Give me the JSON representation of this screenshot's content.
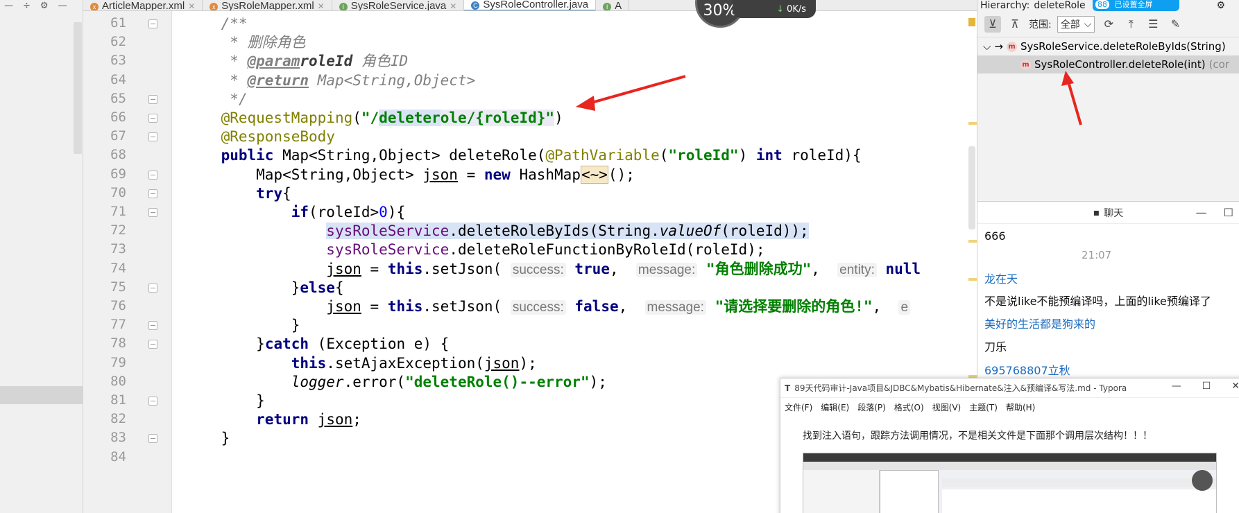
{
  "left_tools": [
    "—",
    "÷",
    "⚙",
    "—"
  ],
  "tabs": [
    {
      "label": "ArticleMapper.xml",
      "kind": "xml",
      "active": false
    },
    {
      "label": "SysRoleMapper.xml",
      "kind": "xml",
      "active": false
    },
    {
      "label": "SysRoleService.java",
      "kind": "interface",
      "active": false
    },
    {
      "label": "SysRoleController.java",
      "kind": "class",
      "active": true
    },
    {
      "label": "A",
      "kind": "interface",
      "active": false
    }
  ],
  "speed_widget": {
    "percent": "30%",
    "down_arrow": "↓",
    "rate": "0K/s"
  },
  "qq_float": {
    "badge": "88",
    "text": "已设置全屏"
  },
  "editor": {
    "line_numbers": [
      "61",
      "62",
      "63",
      "64",
      "65",
      "66",
      "67",
      "68",
      "69",
      "70",
      "71",
      "72",
      "73",
      "74",
      "75",
      "76",
      "77",
      "78",
      "79",
      "80",
      "81",
      "82",
      "83",
      "84"
    ],
    "l61": {
      "text": "    /**"
    },
    "l62": {
      "text": "     * 删除角色"
    },
    "l63": {
      "star": "     * ",
      "tag": "@param",
      "name": "roleId",
      "desc": " 角色ID"
    },
    "l64": {
      "star": "     * ",
      "tag": "@return",
      "desc": " Map<String,Object>"
    },
    "l65": {
      "text": "     */"
    },
    "l66": {
      "indent": "    ",
      "ann": "@RequestMapping",
      "p1": "(",
      "q": "\"/",
      "sel": "deleter",
      "rest": "ole/{roleId}\"",
      "p2": ")"
    },
    "l67": {
      "indent": "    ",
      "ann": "@ResponseBody"
    },
    "l68": {
      "indent": "    ",
      "kw": "public",
      "t1": " Map<String,Object> deleteRole(",
      "ann": "@PathVariable",
      "t2": "(",
      "str": "\"roleId\"",
      "t3": ") ",
      "kw2": "int",
      "t4": " roleId){"
    },
    "l69": {
      "indent": "        ",
      "t1": "Map<String,Object> ",
      "var": "json",
      "t2": " = ",
      "kw": "new",
      "t3": " HashMap",
      "dia": "<~>",
      "t4": "();"
    },
    "l70": {
      "indent": "        ",
      "kw": "try",
      "t1": "{"
    },
    "l71": {
      "indent": "            ",
      "kw": "if",
      "t1": "(roleId>",
      "num": "0",
      "t2": "){"
    },
    "l72": {
      "indent": "                ",
      "fld": "sysRoleService",
      "t1": ".deleteRoleByIds(String.",
      "ital": "valueOf",
      "t2": "(roleId));"
    },
    "l73": {
      "indent": "                ",
      "fld": "sysRoleService",
      "t1": ".deleteRoleFunctionByRoleId(roleId);"
    },
    "l74": {
      "indent": "                ",
      "var": "json",
      "t1": " = ",
      "kw": "this",
      "t2": ".setJson( ",
      "h1": "success:",
      "kw2": " true",
      "t3": ",  ",
      "h2": "message:",
      "str": " \"角色删除成功\"",
      "t4": ",  ",
      "h3": "entity:",
      "kw3": " null"
    },
    "l75": {
      "indent": "            ",
      "t1": "}",
      "kw": "else",
      "t2": "{"
    },
    "l76": {
      "indent": "                ",
      "var": "json",
      "t1": " = ",
      "kw": "this",
      "t2": ".setJson( ",
      "h1": "success:",
      "kw2": " false",
      "t3": ",  ",
      "h2": "message:",
      "str": " \"请选择要删除的角色!\"",
      "t4": ",  ",
      "h3": "e"
    },
    "l77": {
      "indent": "            ",
      "t1": "}"
    },
    "l78": {
      "indent": "        ",
      "t1": "}",
      "kw": "catch",
      "t2": " (Exception e) {"
    },
    "l79": {
      "indent": "            ",
      "kw": "this",
      "t1": ".setAjaxException(",
      "var": "json",
      "t2": ");"
    },
    "l80": {
      "indent": "            ",
      "ital": "logger",
      "t1": ".error(",
      "str": "\"deleteRole()--error\"",
      "t2": ");"
    },
    "l81": {
      "indent": "        ",
      "t1": "}"
    },
    "l82": {
      "indent": "        ",
      "kw": "return",
      "t1": " ",
      "var": "json",
      "t2": ";"
    },
    "l83": {
      "indent": "    ",
      "t1": "}"
    },
    "l84": {
      "text": ""
    }
  },
  "hierarchy": {
    "title": "Hierarchy:",
    "title_value": "deleteRole",
    "scope_label": "范围:",
    "scope_value": "全部",
    "scope_caret": "⌵",
    "toolbar_icons": [
      "callee-icon",
      "caller-icon",
      "refresh-icon",
      "expand-icon",
      "collapse-icon",
      "pin-icon"
    ],
    "gear": "⚙",
    "pin": "⇥",
    "tree": [
      {
        "expander": "⌵",
        "arrow": "→",
        "icon": "m",
        "label": "SysRoleService.deleteRoleByIds(String)",
        "selected": false
      },
      {
        "expander": "",
        "arrow": "",
        "icon": "m",
        "label": "SysRoleController.deleteRole(int)",
        "suffix": "(cor",
        "selected": true
      }
    ]
  },
  "chat": {
    "title": "聊天",
    "minimize": "—",
    "maximize": "☐",
    "messages": [
      {
        "kind": "text",
        "text": "666"
      },
      {
        "kind": "time",
        "text": "21:07"
      },
      {
        "kind": "name",
        "text": "龙在天"
      },
      {
        "kind": "text",
        "text": "不是说like不能预编译吗，上面的like预编译了"
      },
      {
        "kind": "name",
        "text": "美好的生活都是狗来的"
      },
      {
        "kind": "text",
        "text": "刀乐"
      },
      {
        "kind": "name",
        "text": "695768807立秋"
      }
    ]
  },
  "typora": {
    "icon": "T",
    "title": "89天代码审计-Java项目&JDBC&Mybatis&Hibernate&注入&预编译&写法.md - Typora",
    "min": "—",
    "max": "☐",
    "close": "✕",
    "menu": [
      "文件(F)",
      "编辑(E)",
      "段落(P)",
      "格式(O)",
      "视图(V)",
      "主题(T)",
      "帮助(H)"
    ],
    "body_text": "找到注入语句，跟踪方法调用情况，不是相关文件是下面那个调用层次结构！！！"
  },
  "colors": {
    "arrow": "#e8251f",
    "tab_accent": "#4a88c7",
    "selection": "#d8e3f6"
  }
}
